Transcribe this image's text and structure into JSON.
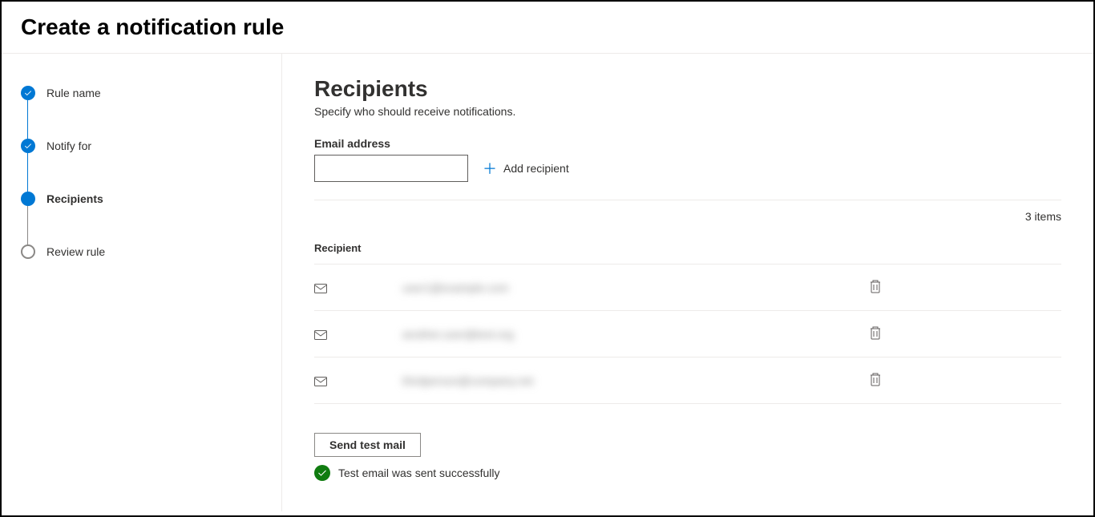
{
  "header": {
    "title": "Create a notification rule"
  },
  "wizard": {
    "steps": [
      {
        "label": "Rule name",
        "state": "completed"
      },
      {
        "label": "Notify for",
        "state": "completed"
      },
      {
        "label": "Recipients",
        "state": "current"
      },
      {
        "label": "Review rule",
        "state": "pending"
      }
    ]
  },
  "main": {
    "title": "Recipients",
    "description": "Specify who should receive notifications.",
    "email_label": "Email address",
    "email_value": "",
    "add_recipient_label": "Add recipient",
    "items_count": "3 items",
    "column_header": "Recipient",
    "recipients": [
      {
        "email": "user1@example.com"
      },
      {
        "email": "another.user@test.org"
      },
      {
        "email": "thirdperson@company.net"
      }
    ],
    "send_test_label": "Send test mail",
    "success_message": "Test email was sent successfully"
  }
}
